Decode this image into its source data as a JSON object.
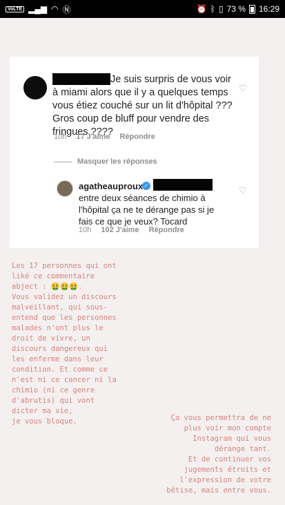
{
  "status_bar": {
    "carrier_badge": "VoLTE",
    "battery": "73 %",
    "time": "16:29"
  },
  "comment": {
    "text": "Je suis surpris de vous voir à miami alors que il y a quelques temps vous étiez couché sur un lit d'hôpital ??? Gros coup de bluff pour vendre des fringues ????",
    "age": "10h",
    "likes": "17 J'aime",
    "reply_label": "Répondre"
  },
  "hide_replies_label": "Masquer les réponses",
  "reply": {
    "username": "agatheauproux",
    "text": "entre deux séances de chimio à l'hôpital ça ne te dérange pas si je fais ce que je veux? Tocard",
    "age": "10h",
    "likes": "102 J'aime",
    "reply_label": "Répondre"
  },
  "story_text_left": "Les 17 personnes qui ont\nliké ce commentaire\nabject : 🤮🤮🤮.\nVous validez un discours\nmalveillant, qui sous-\nentend que les personnes\nmalades n'ont plus le\ndroit de vivre, un\ndiscours dangereux qui\nles enferme dans leur\ncondition. Et comme ce\nn'est ni ce cancer ni la\nchimio (ni ce genre\nd'abrutis) qui vont\ndicter ma vie,\nje vous bloque.",
  "story_text_right": "Ça vous permettra de ne\nplus voir mon compte\nInstagram qui vous\ndérange tant.\nEt de continuer vos\njugements étroits et\nl'expression de votre\nbêtise, mais entre vous.",
  "colors": {
    "story_text": "#d8837e",
    "verified": "#3897f0"
  }
}
